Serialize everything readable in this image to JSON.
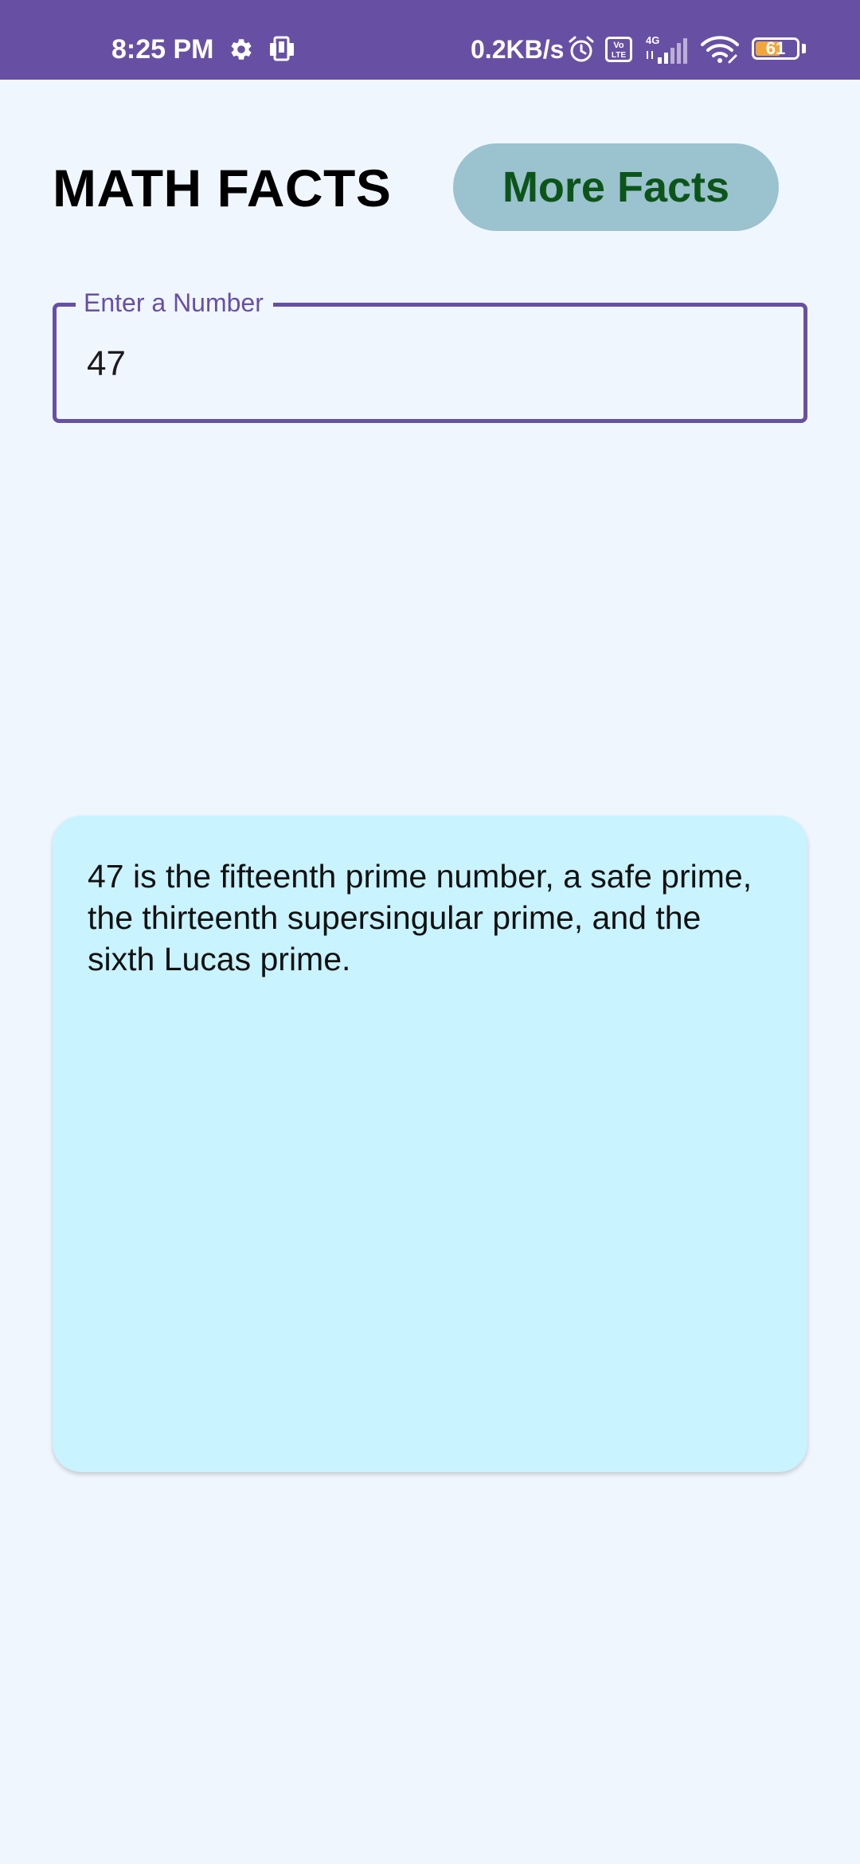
{
  "status_bar": {
    "time": "8:25 PM",
    "network_speed": "0.2KB/s",
    "volte_label": "Vo LTE",
    "network_type": "4G",
    "battery_level": "61",
    "background_color": "#6750a4"
  },
  "header": {
    "title": "MATH FACTS",
    "more_button_label": "More Facts",
    "button_color": "#9bc2cf",
    "button_text_color": "#0c5518"
  },
  "number_field": {
    "label": "Enter a Number",
    "value": "47",
    "accent_color": "#6750a4"
  },
  "fact_card": {
    "text": "47 is the fifteenth prime number, a safe prime, the thirteenth supersingular prime, and the sixth Lucas prime.",
    "background_color": "#c9f3fe"
  },
  "icons": [
    "settings-gear-icon",
    "screen-cast-icon",
    "alarm-icon",
    "volte-icon",
    "cellular-signal-icon",
    "wifi-icon",
    "battery-icon"
  ]
}
